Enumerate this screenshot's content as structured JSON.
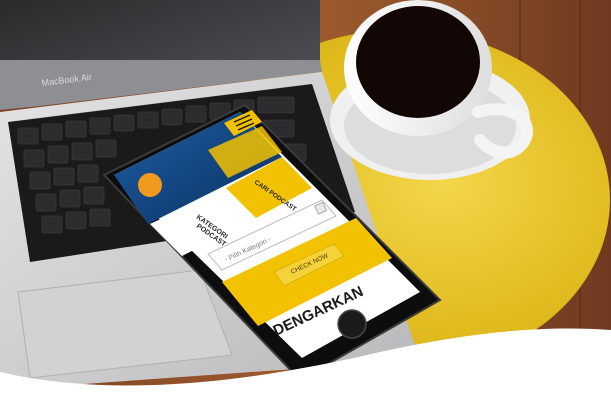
{
  "laptop": {
    "brand_label": "MacBook Air"
  },
  "phone": {
    "tabs": {
      "kategori": "KATEGORI PODCAST",
      "cari": "CARI PODCAST"
    },
    "tab_kategori_lines": [
      "KATEGORI",
      "PODCAST"
    ],
    "select_placeholder": "- Pilih Kategori -",
    "check_button": "CHECK NOW",
    "dengarkan_label": "DENGARKAN"
  },
  "colors": {
    "accent_yellow": "#f2c200",
    "table_yellow": "#e8c81a",
    "wood": "#8a4e2a",
    "laptop_silver": "#c9c9cb",
    "phone_black": "#111111"
  }
}
